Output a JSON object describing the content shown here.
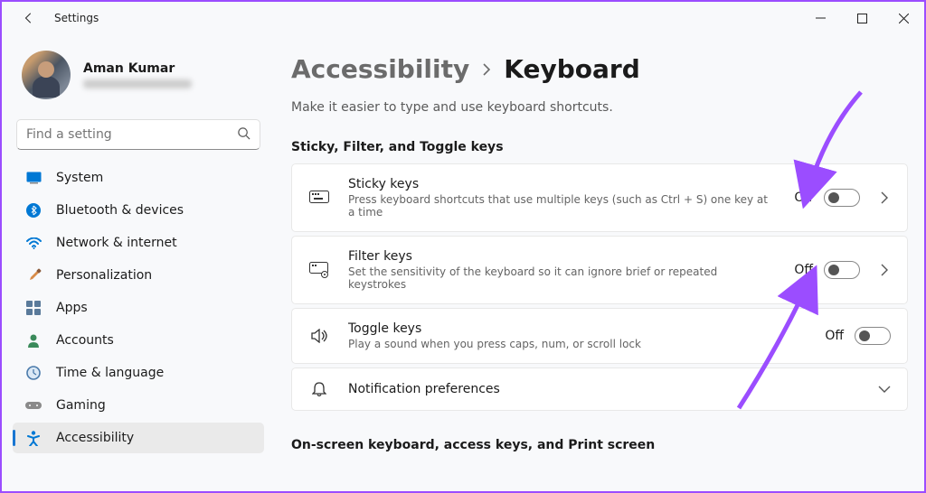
{
  "window": {
    "title": "Settings"
  },
  "profile": {
    "name": "Aman Kumar"
  },
  "search": {
    "placeholder": "Find a setting"
  },
  "sidebar": {
    "items": [
      {
        "label": "System"
      },
      {
        "label": "Bluetooth & devices"
      },
      {
        "label": "Network & internet"
      },
      {
        "label": "Personalization"
      },
      {
        "label": "Apps"
      },
      {
        "label": "Accounts"
      },
      {
        "label": "Time & language"
      },
      {
        "label": "Gaming"
      },
      {
        "label": "Accessibility"
      }
    ]
  },
  "breadcrumb": {
    "parent": "Accessibility",
    "current": "Keyboard"
  },
  "subtitle": "Make it easier to type and use keyboard shortcuts.",
  "sections": {
    "group1": {
      "title": "Sticky, Filter, and Toggle keys",
      "items": [
        {
          "title": "Sticky keys",
          "desc": "Press keyboard shortcuts that use multiple keys (such as Ctrl + S) one key at a time",
          "state": "Off",
          "hasChevron": true
        },
        {
          "title": "Filter keys",
          "desc": "Set the sensitivity of the keyboard so it can ignore brief or repeated keystrokes",
          "state": "Off",
          "hasChevron": true
        },
        {
          "title": "Toggle keys",
          "desc": "Play a sound when you press caps, num, or scroll lock",
          "state": "Off",
          "hasChevron": false
        },
        {
          "title": "Notification preferences",
          "desc": "",
          "state": "",
          "hasChevron": false,
          "expandable": true
        }
      ]
    },
    "group2": {
      "title": "On-screen keyboard, access keys, and Print screen"
    }
  },
  "colors": {
    "accent": "#9b4dff",
    "selection": "#1976d2"
  }
}
